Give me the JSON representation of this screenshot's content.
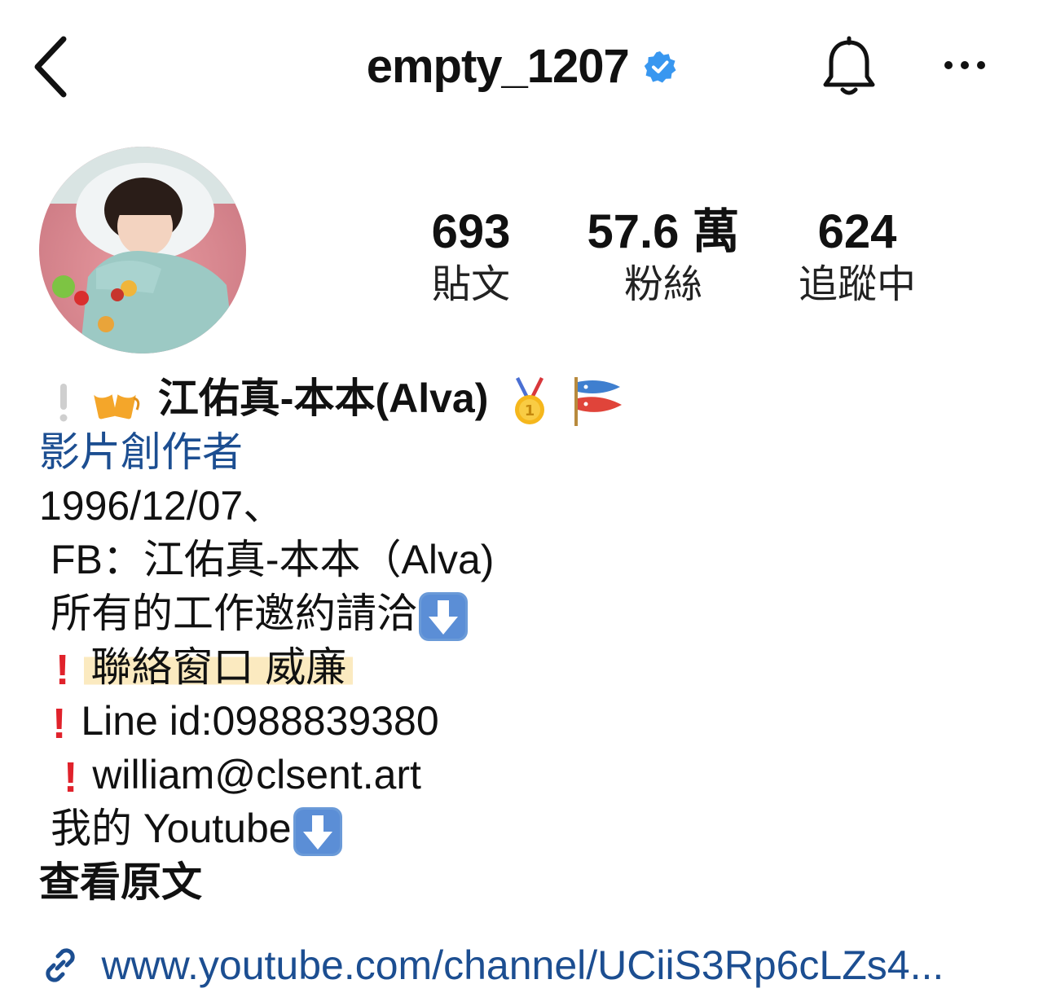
{
  "header": {
    "username": "empty_1207",
    "back_icon": "chevron-left-icon",
    "verified_icon": "verified-badge-icon",
    "bell_icon": "bell-icon",
    "more_icon": "more-horizontal-icon"
  },
  "stats": {
    "posts": {
      "value": "693",
      "label": "貼文"
    },
    "followers": {
      "value": "57.6 萬",
      "label": "粉絲"
    },
    "following": {
      "value": "624",
      "label": "追蹤中"
    }
  },
  "bio": {
    "name": "江佑真-本本(Alva)",
    "category": "影片創作者",
    "birthday": "1996/12/07、",
    "fb": "FB：江佑真-本本（Alva)",
    "work_inquiry": "所有的工作邀約請洽",
    "contact": "聯絡窗口 威廉",
    "line_id": "Line id:0988839380",
    "email": "william@clsent.art",
    "youtube": "我的 Youtube",
    "see_more": "查看原文"
  },
  "link": {
    "url": "www.youtube.com/channel/UCiiS3Rp6cLZs4..."
  },
  "colors": {
    "accent_blue": "#1c4e91",
    "verified_blue": "#3897f0",
    "red": "#e0222b",
    "highlight": "#fbeac0"
  }
}
